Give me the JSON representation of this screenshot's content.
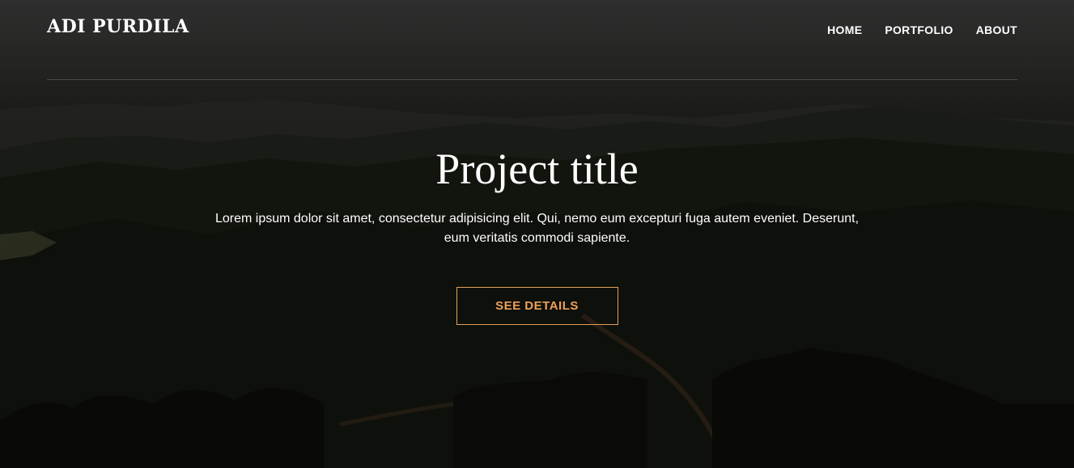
{
  "brand": {
    "name": "ADI PURDILA"
  },
  "nav": {
    "items": [
      {
        "label": "HOME"
      },
      {
        "label": "PORTFOLIO"
      },
      {
        "label": "ABOUT"
      }
    ]
  },
  "hero": {
    "title": "Project title",
    "description": "Lorem ipsum dolor sit amet, consectetur adipisicing elit. Qui, nemo eum excepturi fuga autem eveniet. Deserunt, eum veritatis commodi sapiente.",
    "cta_label": "SEE DETAILS"
  },
  "colors": {
    "accent": "#eda05a",
    "text": "#ffffff"
  }
}
